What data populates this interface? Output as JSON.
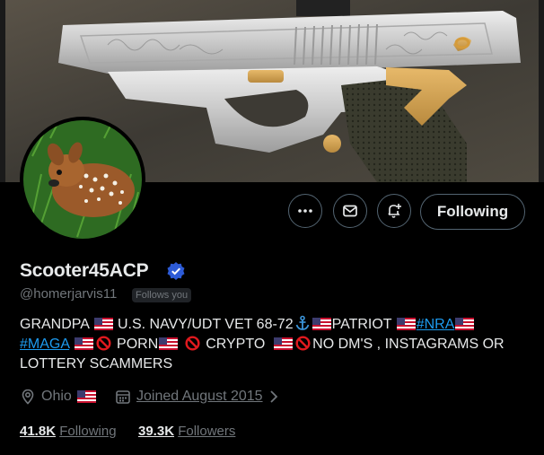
{
  "profile": {
    "display_name": "Scooter45ACP",
    "handle": "@homerjarvis11",
    "follows_you_badge": "Follows you",
    "verified": true
  },
  "actions": {
    "more_icon": "more-icon",
    "message_icon": "mail-icon",
    "notify_icon": "bell-plus-icon",
    "follow_label": "Following"
  },
  "bio": {
    "t1": "GRANDPA",
    "t2": "U.S. NAVY/UDT VET 68-72",
    "t3": "PATRIOT",
    "link_nra": "#NRA",
    "link_maga": "#MAGA",
    "t4": "PORN",
    "t5": "CRYPTO",
    "t6": "NO DM'S , INSTAGRAMS OR",
    "t7": "LOTTERY SCAMMERS"
  },
  "meta": {
    "location": "Ohio",
    "joined": "Joined August 2015"
  },
  "stats": {
    "following_count": "41.8K",
    "following_label": "Following",
    "followers_count": "39.3K",
    "followers_label": "Followers"
  },
  "colors": {
    "background": "#000000",
    "text": "#e7e9ea",
    "muted": "#71767b",
    "link": "#1d9bf0",
    "verified": "#2d5bd7",
    "border": "#536471"
  }
}
